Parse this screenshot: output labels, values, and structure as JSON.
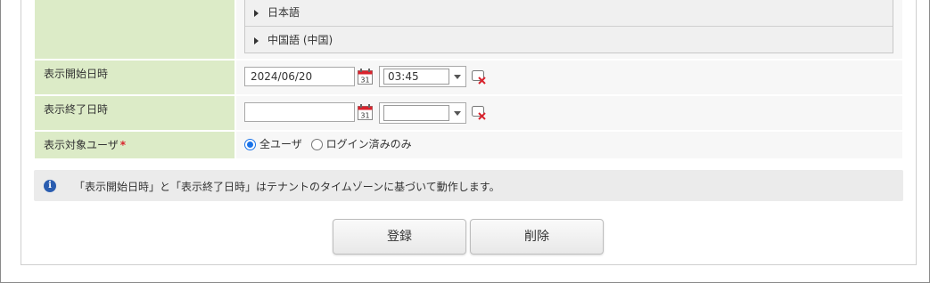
{
  "languages": [
    "日本語",
    "中国語 (中国)"
  ],
  "fields": {
    "start": {
      "label": "表示開始日時",
      "date": "2024/06/20",
      "time": "03:45"
    },
    "end": {
      "label": "表示終了日時",
      "date": "",
      "time": ""
    },
    "target": {
      "label": "表示対象ユーザ",
      "required_mark": "*",
      "options": [
        "全ユーザ",
        "ログイン済みのみ"
      ],
      "selected": "全ユーザ"
    }
  },
  "info": {
    "icon": "info-icon",
    "text": "「表示開始日時」と「表示終了日時」はテナントのタイムゾーンに基づいて動作します。"
  },
  "buttons": {
    "register": "登録",
    "delete": "削除"
  },
  "colors": {
    "label_bg": "#dcebc7",
    "radio_accent": "#1a73e8",
    "calendar_red": "#d9232d"
  }
}
